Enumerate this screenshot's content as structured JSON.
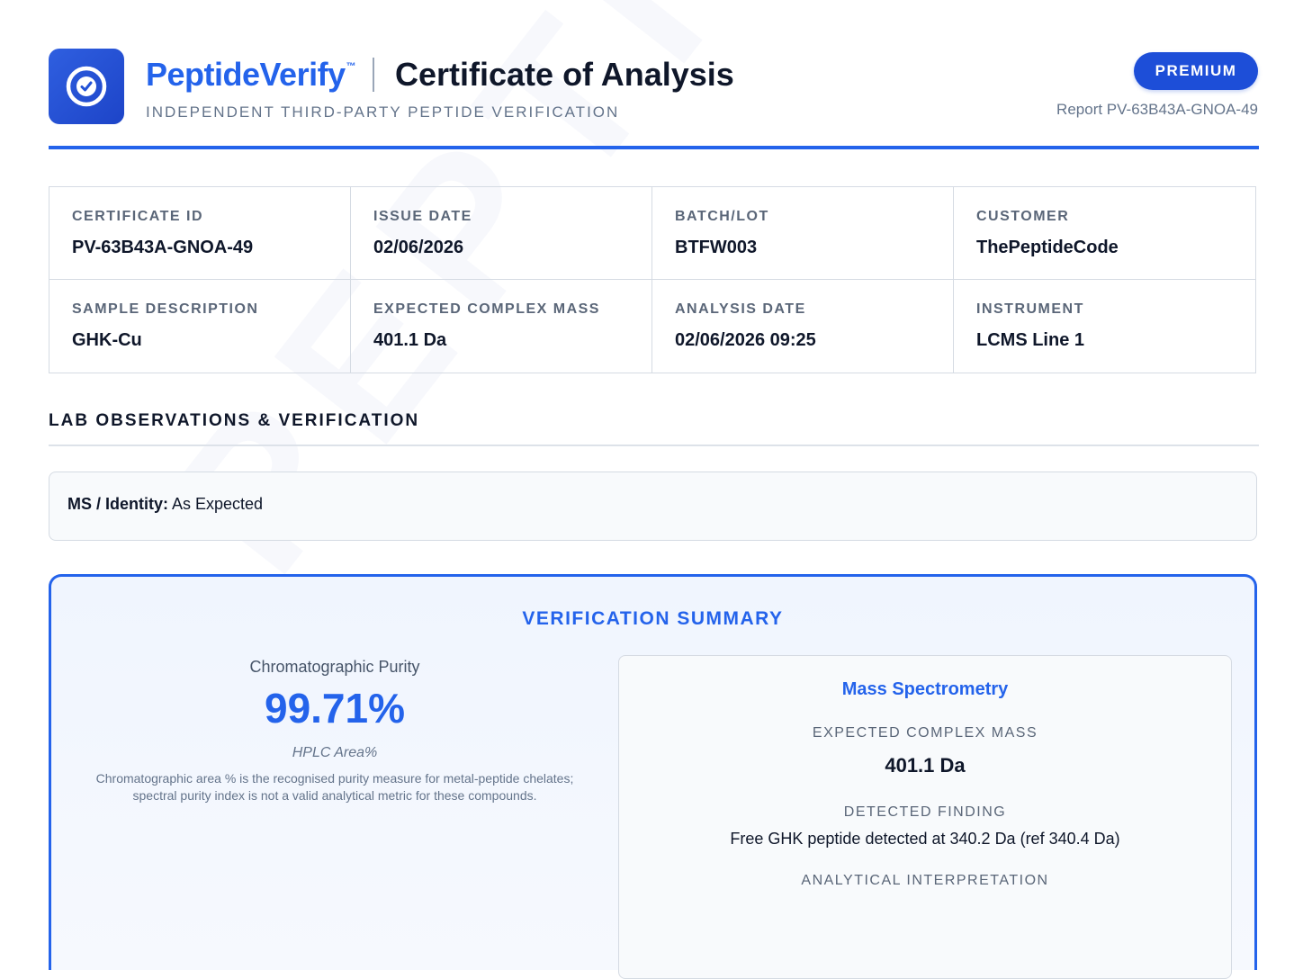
{
  "header": {
    "brand": "PeptideVerify",
    "trademark": "™",
    "title": "Certificate of Analysis",
    "tagline": "INDEPENDENT THIRD-PARTY PEPTIDE VERIFICATION",
    "badge": "PREMIUM",
    "report_number": "Report PV-63B43A-GNOA-49",
    "logo_icon": "check-seal-icon",
    "accent_color": "#2463eb"
  },
  "watermark": "PEPTIDEVERIFY",
  "info": {
    "certificate_id": {
      "label": "CERTIFICATE ID",
      "value": "PV-63B43A-GNOA-49"
    },
    "issue_date": {
      "label": "ISSUE DATE",
      "value": "02/06/2026"
    },
    "batch_lot": {
      "label": "BATCH/LOT",
      "value": "BTFW003"
    },
    "customer": {
      "label": "CUSTOMER",
      "value": "ThePeptideCode"
    },
    "sample_description": {
      "label": "SAMPLE DESCRIPTION",
      "value": "GHK-Cu"
    },
    "expected_mass": {
      "label": "EXPECTED COMPLEX MASS",
      "value": "401.1 Da"
    },
    "analysis_date": {
      "label": "ANALYSIS DATE",
      "value": "02/06/2026 09:25"
    },
    "instrument": {
      "label": "INSTRUMENT",
      "value": "LCMS Line 1"
    }
  },
  "observations": {
    "title": "LAB OBSERVATIONS & VERIFICATION",
    "ms_identity_label": "MS / Identity:",
    "ms_identity_value": "As Expected"
  },
  "summary": {
    "title": "VERIFICATION SUMMARY",
    "purity": {
      "label": "Chromatographic Purity",
      "value": "99.71%",
      "method": "HPLC Area%",
      "note": "Chromatographic area % is the recognised purity measure for metal-peptide chelates; spectral purity index is not a valid analytical metric for these compounds."
    },
    "mass_spec": {
      "title": "Mass Spectrometry",
      "expected_label": "EXPECTED COMPLEX MASS",
      "expected_value": "401.1 Da",
      "finding_label": "DETECTED FINDING",
      "finding_value": "Free GHK peptide detected at 340.2 Da (ref 340.4 Da)",
      "interpretation_label": "ANALYTICAL INTERPRETATION"
    }
  }
}
